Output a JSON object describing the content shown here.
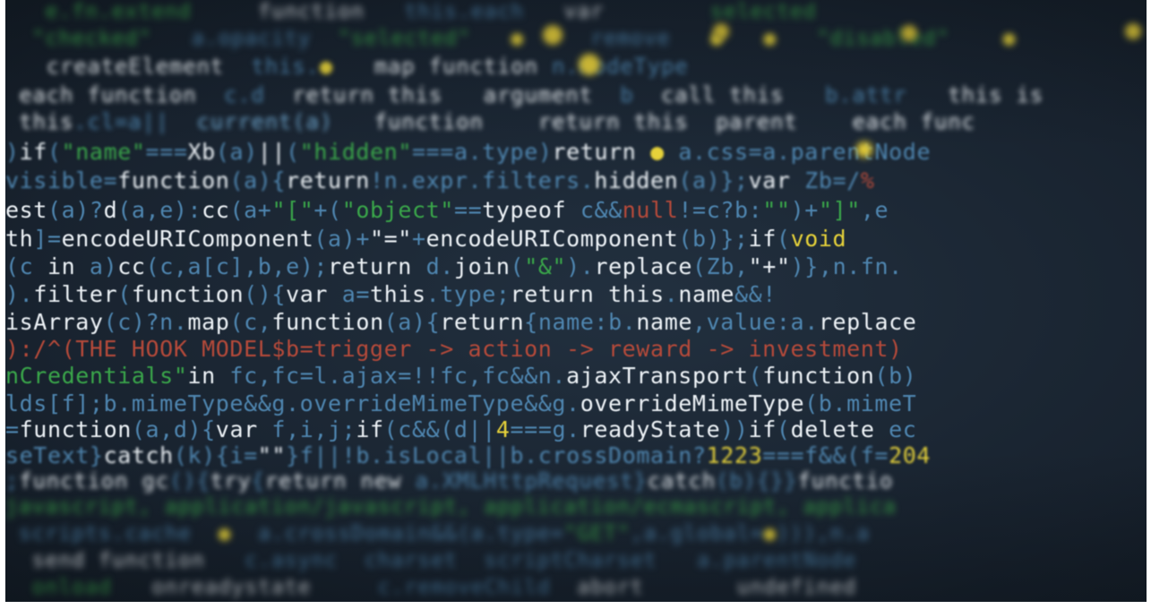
{
  "colors": {
    "background": "#1b2734",
    "white": "#eef3f7",
    "blue": "#4f86b0",
    "cyan": "#6fa7cf",
    "green": "#3aa64a",
    "red": "#b54a3a",
    "yellow": "#e6d23a"
  },
  "lines": [
    {
      "blur": "vsoft",
      "segments": [
        {
          "t": "   ",
          "c": "blue"
        },
        {
          "t": "e.fn.extend",
          "c": "green"
        },
        {
          "t": "     ",
          "c": "blue"
        },
        {
          "t": "function",
          "c": "white"
        },
        {
          "t": "   this.each",
          "c": "blue"
        },
        {
          "t": "   ",
          "c": "blue"
        },
        {
          "t": "var",
          "c": "white"
        },
        {
          "t": "        ",
          "c": "blue"
        },
        {
          "t": "selected",
          "c": "green"
        }
      ]
    },
    {
      "blur": "vsoft",
      "segments": [
        {
          "t": "  ",
          "c": "blue"
        },
        {
          "t": "\"checked\"",
          "c": "green"
        },
        {
          "t": "   a.opacity  ",
          "c": "blue"
        },
        {
          "t": "\"selected\"",
          "c": "green"
        },
        {
          "t": "   ",
          "c": "blue"
        },
        {
          "t": "●",
          "c": "yellow"
        },
        {
          "t": "     remove   ",
          "c": "blue"
        },
        {
          "t": "●",
          "c": "yellow"
        },
        {
          "t": "   ",
          "c": "blue"
        },
        {
          "t": "●",
          "c": "yellow"
        },
        {
          "t": "   \"disabled\"    ",
          "c": "green"
        },
        {
          "t": "●",
          "c": "yellow"
        }
      ]
    },
    {
      "blur": "soft",
      "segments": [
        {
          "t": "   ",
          "c": "blue"
        },
        {
          "t": "createElement",
          "c": "white"
        },
        {
          "t": "  this.",
          "c": "blue"
        },
        {
          "t": "●",
          "c": "yellow"
        },
        {
          "t": "   ",
          "c": "blue"
        },
        {
          "t": "map",
          "c": "white"
        },
        {
          "t": " ",
          "c": "blue"
        },
        {
          "t": "function",
          "c": "white"
        },
        {
          "t": " n.nodeType",
          "c": "blue"
        }
      ]
    },
    {
      "blur": "soft",
      "segments": [
        {
          "t": " ",
          "c": "blue"
        },
        {
          "t": "each function",
          "c": "white"
        },
        {
          "t": "  c.d  ",
          "c": "blue"
        },
        {
          "t": "return this",
          "c": "white"
        },
        {
          "t": "   ",
          "c": "blue"
        },
        {
          "t": "argument",
          "c": "white"
        },
        {
          "t": "  b  ",
          "c": "blue"
        },
        {
          "t": "call this",
          "c": "white"
        },
        {
          "t": "   b.attr   ",
          "c": "blue"
        },
        {
          "t": "this is",
          "c": "white"
        }
      ]
    },
    {
      "blur": "soft",
      "segments": [
        {
          "t": " ",
          "c": "blue"
        },
        {
          "t": "this",
          "c": "white"
        },
        {
          "t": ".cl=a||  ",
          "c": "blue"
        },
        {
          "t": "current(a)",
          "c": "cyan"
        },
        {
          "t": "   ",
          "c": "blue"
        },
        {
          "t": "function",
          "c": "white"
        },
        {
          "t": "    ",
          "c": "blue"
        },
        {
          "t": "return this",
          "c": "white"
        },
        {
          "t": "  ",
          "c": "blue"
        },
        {
          "t": "parent",
          "c": "white"
        },
        {
          "t": "    ",
          "c": "blue"
        },
        {
          "t": "each func",
          "c": "white"
        }
      ]
    },
    {
      "blur": "mid",
      "segments": [
        {
          "t": ")",
          "c": "blue"
        },
        {
          "t": "if",
          "c": "white"
        },
        {
          "t": "(",
          "c": "blue"
        },
        {
          "t": "\"name\"",
          "c": "green"
        },
        {
          "t": "===",
          "c": "blue"
        },
        {
          "t": "Xb",
          "c": "white"
        },
        {
          "t": "(a)",
          "c": "blue"
        },
        {
          "t": "||",
          "c": "white"
        },
        {
          "t": "(",
          "c": "blue"
        },
        {
          "t": "\"hidden\"",
          "c": "green"
        },
        {
          "t": "===a.type)",
          "c": "blue"
        },
        {
          "t": "return",
          "c": "white"
        },
        {
          "t": " ",
          "c": "blue"
        },
        {
          "t": "●",
          "c": "yellow"
        },
        {
          "t": " a.css=a.parentNode",
          "c": "blue"
        }
      ]
    },
    {
      "blur": "mid",
      "segments": [
        {
          "t": "visible=",
          "c": "blue"
        },
        {
          "t": "function",
          "c": "white"
        },
        {
          "t": "(a){",
          "c": "blue"
        },
        {
          "t": "return",
          "c": "white"
        },
        {
          "t": "!n.expr.filters.",
          "c": "blue"
        },
        {
          "t": "hidden",
          "c": "white"
        },
        {
          "t": "(a)};",
          "c": "blue"
        },
        {
          "t": "var",
          "c": "white"
        },
        {
          "t": " Zb=/",
          "c": "blue"
        },
        {
          "t": "%",
          "c": "red"
        }
      ]
    },
    {
      "blur": "sharp",
      "segments": [
        {
          "t": "est",
          "c": "white"
        },
        {
          "t": "(a)?",
          "c": "blue"
        },
        {
          "t": "d",
          "c": "white"
        },
        {
          "t": "(a,e):",
          "c": "blue"
        },
        {
          "t": "cc",
          "c": "white"
        },
        {
          "t": "(a+",
          "c": "blue"
        },
        {
          "t": "\"[\"",
          "c": "green"
        },
        {
          "t": "+(",
          "c": "blue"
        },
        {
          "t": "\"object\"",
          "c": "green"
        },
        {
          "t": "==",
          "c": "blue"
        },
        {
          "t": "typeof",
          "c": "white"
        },
        {
          "t": " c&&",
          "c": "blue"
        },
        {
          "t": "null",
          "c": "red"
        },
        {
          "t": "!=c?b:",
          "c": "blue"
        },
        {
          "t": "\"\"",
          "c": "green"
        },
        {
          "t": ")+",
          "c": "blue"
        },
        {
          "t": "\"]\"",
          "c": "green"
        },
        {
          "t": ",e",
          "c": "blue"
        }
      ]
    },
    {
      "blur": "sharp",
      "segments": [
        {
          "t": "th",
          "c": "white"
        },
        {
          "t": "]=",
          "c": "blue"
        },
        {
          "t": "encodeURIComponent",
          "c": "white"
        },
        {
          "t": "(a)+",
          "c": "blue"
        },
        {
          "t": "\"=\"",
          "c": "white"
        },
        {
          "t": "+",
          "c": "blue"
        },
        {
          "t": "encodeURIComponent",
          "c": "white"
        },
        {
          "t": "(b)};",
          "c": "blue"
        },
        {
          "t": "if",
          "c": "white"
        },
        {
          "t": "(",
          "c": "blue"
        },
        {
          "t": "void",
          "c": "yellow"
        }
      ]
    },
    {
      "blur": "sharp",
      "segments": [
        {
          "t": "(c ",
          "c": "blue"
        },
        {
          "t": "in",
          "c": "white"
        },
        {
          "t": " a)",
          "c": "blue"
        },
        {
          "t": "cc",
          "c": "white"
        },
        {
          "t": "(c,a[c],b,e);",
          "c": "blue"
        },
        {
          "t": "return",
          "c": "white"
        },
        {
          "t": " d.",
          "c": "blue"
        },
        {
          "t": "join",
          "c": "white"
        },
        {
          "t": "(",
          "c": "blue"
        },
        {
          "t": "\"&\"",
          "c": "green"
        },
        {
          "t": ").",
          "c": "blue"
        },
        {
          "t": "replace",
          "c": "white"
        },
        {
          "t": "(Zb,",
          "c": "blue"
        },
        {
          "t": "\"+\"",
          "c": "white"
        },
        {
          "t": ")},n.fn.",
          "c": "blue"
        }
      ]
    },
    {
      "blur": "sharp",
      "segments": [
        {
          "t": ").",
          "c": "blue"
        },
        {
          "t": "filter",
          "c": "white"
        },
        {
          "t": "(",
          "c": "blue"
        },
        {
          "t": "function",
          "c": "white"
        },
        {
          "t": "(){",
          "c": "blue"
        },
        {
          "t": "var",
          "c": "white"
        },
        {
          "t": " a=",
          "c": "blue"
        },
        {
          "t": "this",
          "c": "white"
        },
        {
          "t": ".type;",
          "c": "blue"
        },
        {
          "t": "return",
          "c": "white"
        },
        {
          "t": " ",
          "c": "blue"
        },
        {
          "t": "this",
          "c": "white"
        },
        {
          "t": ".",
          "c": "blue"
        },
        {
          "t": "name",
          "c": "white"
        },
        {
          "t": "&&!",
          "c": "blue"
        }
      ]
    },
    {
      "blur": "sharp",
      "segments": [
        {
          "t": "isArray",
          "c": "white"
        },
        {
          "t": "(c)?n.",
          "c": "blue"
        },
        {
          "t": "map",
          "c": "white"
        },
        {
          "t": "(c,",
          "c": "blue"
        },
        {
          "t": "function",
          "c": "white"
        },
        {
          "t": "(a){",
          "c": "blue"
        },
        {
          "t": "return",
          "c": "white"
        },
        {
          "t": "{name:b.",
          "c": "blue"
        },
        {
          "t": "name",
          "c": "white"
        },
        {
          "t": ",value:a.",
          "c": "blue"
        },
        {
          "t": "replace",
          "c": "white"
        }
      ]
    },
    {
      "blur": "sharp",
      "segments": [
        {
          "t": "):/^(THE HOOK MODEL$b=trigger -> action -> reward -> investment)",
          "c": "red"
        }
      ]
    },
    {
      "blur": "sharp",
      "segments": [
        {
          "t": "nCredentials\"",
          "c": "green"
        },
        {
          "t": "in",
          "c": "white"
        },
        {
          "t": " fc,fc=l.ajax=!!fc,fc&&n.",
          "c": "blue"
        },
        {
          "t": "ajaxTransport",
          "c": "white"
        },
        {
          "t": "(",
          "c": "blue"
        },
        {
          "t": "function",
          "c": "white"
        },
        {
          "t": "(b)",
          "c": "blue"
        }
      ]
    },
    {
      "blur": "sharp",
      "segments": [
        {
          "t": "lds[f];b.mimeType&&g.overrideMimeType&&g.",
          "c": "blue"
        },
        {
          "t": "overrideMimeType",
          "c": "white"
        },
        {
          "t": "(b.mimeT",
          "c": "blue"
        }
      ]
    },
    {
      "blur": "sharp",
      "segments": [
        {
          "t": "=",
          "c": "blue"
        },
        {
          "t": "function",
          "c": "white"
        },
        {
          "t": "(a,d){",
          "c": "blue"
        },
        {
          "t": "var",
          "c": "white"
        },
        {
          "t": " f,i,j;",
          "c": "blue"
        },
        {
          "t": "if",
          "c": "white"
        },
        {
          "t": "(c&&(d||",
          "c": "blue"
        },
        {
          "t": "4",
          "c": "yellow"
        },
        {
          "t": "===g.",
          "c": "blue"
        },
        {
          "t": "readyState",
          "c": "white"
        },
        {
          "t": "))",
          "c": "blue"
        },
        {
          "t": "if",
          "c": "white"
        },
        {
          "t": "(",
          "c": "blue"
        },
        {
          "t": "delete",
          "c": "white"
        },
        {
          "t": " ec",
          "c": "blue"
        }
      ]
    },
    {
      "blur": "mid",
      "segments": [
        {
          "t": "seText}",
          "c": "blue"
        },
        {
          "t": "catch",
          "c": "white"
        },
        {
          "t": "(k){i=",
          "c": "blue"
        },
        {
          "t": "\"\"",
          "c": "white"
        },
        {
          "t": "}f||!b.isLocal||b.crossDomain?",
          "c": "blue"
        },
        {
          "t": "1223",
          "c": "yellow"
        },
        {
          "t": "===f&&(f=",
          "c": "blue"
        },
        {
          "t": "204",
          "c": "yellow"
        }
      ]
    },
    {
      "blur": "soft",
      "segments": [
        {
          "t": ";",
          "c": "blue"
        },
        {
          "t": "function",
          "c": "white"
        },
        {
          "t": " ",
          "c": "blue"
        },
        {
          "t": "gc",
          "c": "white"
        },
        {
          "t": "(){",
          "c": "blue"
        },
        {
          "t": "try",
          "c": "white"
        },
        {
          "t": "{",
          "c": "blue"
        },
        {
          "t": "return",
          "c": "white"
        },
        {
          "t": " ",
          "c": "blue"
        },
        {
          "t": "new",
          "c": "white"
        },
        {
          "t": " a.XMLHttpRequest}",
          "c": "blue"
        },
        {
          "t": "catch",
          "c": "white"
        },
        {
          "t": "(b){}}",
          "c": "blue"
        },
        {
          "t": "functio",
          "c": "white"
        }
      ]
    },
    {
      "blur": "vsoft",
      "segments": [
        {
          "t": "javascript, application/javascript, application/ecmascript, applica",
          "c": "green"
        }
      ]
    },
    {
      "blur": "vsoft",
      "segments": [
        {
          "t": " scripts.cache  ",
          "c": "blue"
        },
        {
          "t": "●",
          "c": "yellow"
        },
        {
          "t": "  a.crossDomain&&(a.type=",
          "c": "blue"
        },
        {
          "t": "\"GET\"",
          "c": "green"
        },
        {
          "t": ",a.global=",
          "c": "blue"
        },
        {
          "t": "●",
          "c": "yellow"
        },
        {
          "t": "))),n.a",
          "c": "blue"
        }
      ]
    },
    {
      "blur": "vsoft",
      "segments": [
        {
          "t": "  ",
          "c": "blue"
        },
        {
          "t": "send function",
          "c": "white"
        },
        {
          "t": "   c.async  charset  scriptCharset   a.parentNode",
          "c": "blue"
        }
      ]
    },
    {
      "blur": "vsoft",
      "segments": [
        {
          "t": "  ",
          "c": "blue"
        },
        {
          "t": "onload",
          "c": "green"
        },
        {
          "t": "   ",
          "c": "blue"
        },
        {
          "t": "onreadystate",
          "c": "white"
        },
        {
          "t": "     c.removeChild  ",
          "c": "blue"
        },
        {
          "t": "abort",
          "c": "white"
        },
        {
          "t": "       ",
          "c": "blue"
        },
        {
          "t": "undefined",
          "c": "white"
        }
      ]
    }
  ]
}
